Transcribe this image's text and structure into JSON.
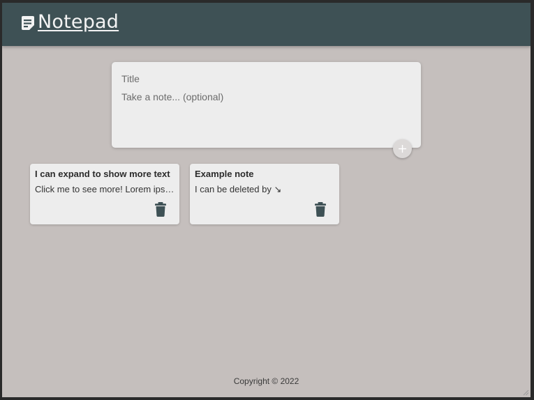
{
  "header": {
    "title": "Notepad",
    "icon": "sticky-note-icon",
    "background_color": "#3e5155"
  },
  "composer": {
    "title_placeholder": "Title",
    "content_placeholder": "Take a note... (optional)",
    "add_icon": "plus-icon"
  },
  "notes": [
    {
      "title": "I can expand to show more text",
      "content": "Click me to see more! Lorem ipsum dolor sit amet",
      "delete_icon": "trash-icon"
    },
    {
      "title": "Example note",
      "content": "I can be deleted by ↘",
      "delete_icon": "trash-icon"
    }
  ],
  "footer": {
    "copyright": "Copyright © 2022"
  },
  "colors": {
    "page_background": "#c5bfbd",
    "card_background": "#ededed",
    "accent": "#3e5155"
  }
}
